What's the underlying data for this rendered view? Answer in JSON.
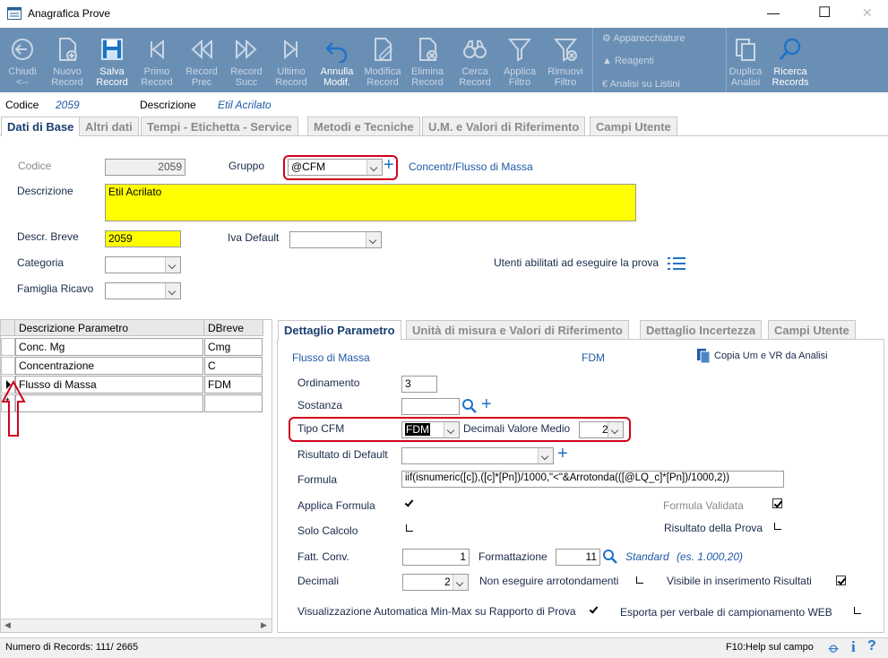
{
  "window": {
    "title": "Anagrafica Prove",
    "min": "—",
    "max": "☐",
    "close": "✕"
  },
  "toolbar": {
    "buttons": [
      {
        "id": "chiudi",
        "l1": "Chiudi",
        "l2": "<--",
        "icon": "back-arrow-icon",
        "enabled": false
      },
      {
        "id": "nuovo",
        "l1": "Nuovo",
        "l2": "Record",
        "icon": "new-doc-icon",
        "enabled": false
      },
      {
        "id": "salva",
        "l1": "Salva",
        "l2": "Record",
        "icon": "save-icon",
        "enabled": true
      },
      {
        "id": "primo",
        "l1": "Primo",
        "l2": "Record",
        "icon": "first-icon",
        "enabled": false
      },
      {
        "id": "prec",
        "l1": "Record",
        "l2": "Prec",
        "icon": "prev-icon",
        "enabled": false
      },
      {
        "id": "succ",
        "l1": "Record",
        "l2": "Succ",
        "icon": "next-icon",
        "enabled": false
      },
      {
        "id": "ultimo",
        "l1": "Ultimo",
        "l2": "Record",
        "icon": "last-icon",
        "enabled": false
      },
      {
        "id": "annulla",
        "l1": "Annulla",
        "l2": "Modif.",
        "icon": "undo-icon",
        "enabled": true
      },
      {
        "id": "modifica",
        "l1": "Modifica",
        "l2": "Record",
        "icon": "edit-icon",
        "enabled": false
      },
      {
        "id": "elimina",
        "l1": "Elimina",
        "l2": "Record",
        "icon": "delete-icon",
        "enabled": false
      },
      {
        "id": "cerca",
        "l1": "Cerca",
        "l2": "Record",
        "icon": "binoculars-icon",
        "enabled": false
      },
      {
        "id": "applica",
        "l1": "Applica",
        "l2": "Filtro",
        "icon": "filter-icon",
        "enabled": false
      },
      {
        "id": "rimuovi",
        "l1": "Rimuovi",
        "l2": "Filtro",
        "icon": "remove-filter-icon",
        "enabled": false
      }
    ],
    "side": {
      "apparecchiature": "Apparecchiature",
      "reagenti": "Reagenti",
      "listini": "Analisi su Listini"
    },
    "duplica": {
      "l1": "Duplica",
      "l2": "Analisi"
    },
    "ricerca": {
      "l1": "Ricerca",
      "l2": "Records"
    }
  },
  "header": {
    "codice_label": "Codice",
    "codice": "2059",
    "descrizione_label": "Descrizione",
    "descrizione": "Etil Acrilato"
  },
  "tabs": [
    "Dati di Base",
    "Altri dati",
    "Tempi - Etichetta - Service",
    "Metodi e Tecniche",
    "U.M. e Valori di Riferimento",
    "Campi Utente"
  ],
  "base": {
    "codice_label": "Codice",
    "codice": "2059",
    "gruppo_label": "Gruppo",
    "gruppo": "@CFM",
    "gruppo_desc": "Concentr/Flusso di Massa",
    "descrizione_label": "Descrizione",
    "descrizione": "Etil Acrilato",
    "breve_label": "Descr. Breve",
    "breve": "2059",
    "iva_label": "Iva Default",
    "iva": "",
    "categoria_label": "Categoria",
    "categoria": "",
    "famiglia_label": "Famiglia Ricavo",
    "famiglia": "",
    "utenti_label": "Utenti abilitati ad eseguire la prova"
  },
  "grid": {
    "col1": "Descrizione Parametro",
    "col2": "DBreve",
    "rows": [
      {
        "desc": "Conc. Mg",
        "breve": "Cmg"
      },
      {
        "desc": "Concentrazione",
        "breve": "C"
      },
      {
        "desc": "Flusso di Massa",
        "breve": "FDM"
      }
    ],
    "new_row_marker": "*"
  },
  "detail_tabs": [
    "Dettaglio Parametro",
    "Unità di misura e Valori di Riferimento",
    "Dettaglio Incertezza",
    "Campi Utente"
  ],
  "detail": {
    "nome": "Flusso di Massa",
    "sigla": "FDM",
    "copia": "Copia Um e VR da Analisi",
    "ordinamento_label": "Ordinamento",
    "ordinamento": "3",
    "sostanza_label": "Sostanza",
    "sostanza": "",
    "tipo_label": "Tipo CFM",
    "tipo": "FDM",
    "decimali_medio_label": "Decimali Valore Medio",
    "decimali_medio": "2",
    "risultato_label": "Risultato di Default",
    "risultato": "",
    "formula_label": "Formula",
    "formula": "iif(isnumeric([c]),([c]*[Pn])/1000,\"<\"&Arrotonda(([@LQ_c]*[Pn])/1000,2))",
    "applica_label": "Applica Formula",
    "validata_label": "Formula Validata",
    "solo_label": "Solo Calcolo",
    "risultato_prova_label": "Risultato della Prova",
    "fatt_label": "Fatt. Conv.",
    "fatt": "1",
    "formattazione_label": "Formattazione",
    "formattazione": "11",
    "standard": "Standard",
    "standard_ex": "(es. 1.000,20)",
    "decimali_label": "Decimali",
    "decimali": "2",
    "arrot_label": "Non eseguire arrotondamenti",
    "visibile_label": "Visibile in inserimento Risultati",
    "minmax_label": "Visualizzazione Automatica Min-Max su Rapporto di Prova",
    "esporta_label": "Esporta per verbale di campionamento WEB"
  },
  "status": {
    "records": "Numero di Records: 111/ 2665",
    "help": "F10:Help sul campo"
  },
  "colors": {
    "toolbar": "#6a8fb5",
    "accent": "#1a3e70",
    "highlight": "#ffff00",
    "red": "#d0021b"
  }
}
